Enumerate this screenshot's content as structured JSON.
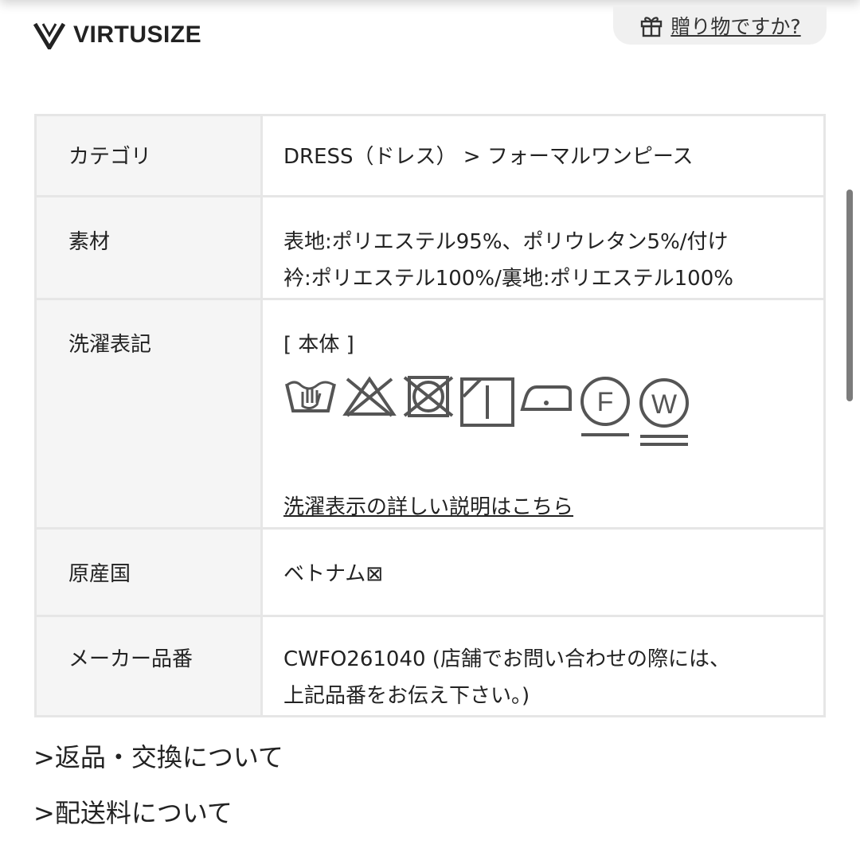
{
  "brand": {
    "name": "VIRTUSIZE",
    "logo_icon": "virtusize-v-logo"
  },
  "gift": {
    "icon": "gift-icon",
    "label": "贈り物ですか?"
  },
  "spec_table": {
    "category": {
      "label": "カテゴリ",
      "value": "DRESS（ドレス） > フォーマルワンピース"
    },
    "material": {
      "label": "素材",
      "line1": "表地:ポリエステル95%、ポリウレタン5%/付け",
      "line2": "衿:ポリエステル100%/裏地:ポリエステル100%"
    },
    "washing": {
      "label": "洗濯表記",
      "section": "[ 本体 ]",
      "symbols": [
        "hand-wash-icon",
        "no-bleach-icon",
        "no-tumble-dry-icon",
        "line-dry-shade-icon",
        "iron-low-icon",
        "dry-clean-f-icon",
        "wet-clean-w-icon"
      ],
      "link": "洗濯表示の詳しい説明はこちら"
    },
    "origin": {
      "label": "原産国",
      "value": "ベトナム⊠"
    },
    "maker": {
      "label": "メーカー品番",
      "line1": "CWFO261040 (店舗でお問い合わせの際には、",
      "line2": "上記品番をお伝え下さい。)"
    }
  },
  "links": {
    "returns": ">返品・交換について",
    "shipping": ">配送料について"
  }
}
